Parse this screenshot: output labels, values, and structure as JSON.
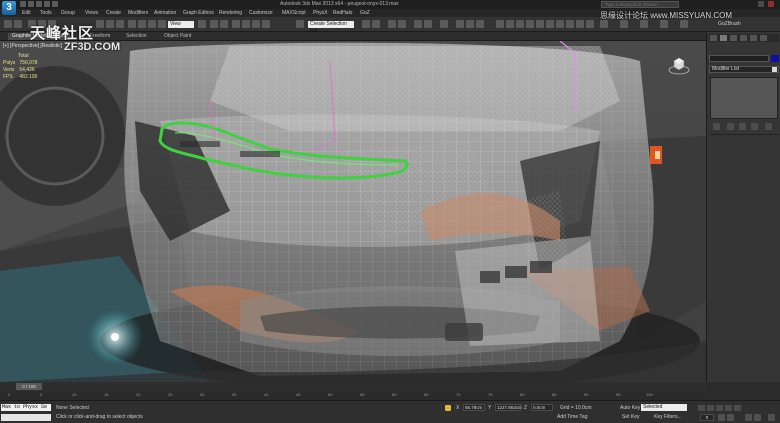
{
  "titlebar": {
    "app_badge": "3",
    "title": "Autodesk 3ds Max 2013 x64 - peugeot-onyx-013.max",
    "search_placeholder": "Type a keyword or phrase"
  },
  "menu": [
    "Edit",
    "Tools",
    "Group",
    "Views",
    "Create",
    "Modifiers",
    "Animation",
    "Graph Editors",
    "Rendering",
    "Customize",
    "MAXScript",
    "PhysX",
    "RedHalo",
    "GoZ"
  ],
  "toolbar": {
    "selection_filter": "All",
    "reference_coord": "View",
    "named_selection": "Create Selection Set"
  },
  "ribbon": {
    "tabs": [
      "Graphite Modeling Tools",
      "Freeform",
      "Selection",
      "Object Paint"
    ]
  },
  "viewport": {
    "label": "[+] [Perspective] [Realistic]",
    "stats": {
      "header": "Total",
      "rows": [
        {
          "key": "Polys",
          "value": "756,078"
        },
        {
          "key": "Verts",
          "value": "54,426"
        },
        {
          "key": "FPS",
          "value": "482.195"
        }
      ]
    }
  },
  "watermark": {
    "brand": "天峰社区",
    "site": "ZF3D.COM",
    "corner": "思缘设计论坛 www.MISSYUAN.COM"
  },
  "command_panel": {
    "goz_label": "GoZBrush",
    "modifier_list": "Modifier List"
  },
  "timeline": {
    "slider": "0 / 100",
    "ticks": [
      "0",
      "5",
      "10",
      "15",
      "20",
      "25",
      "30",
      "35",
      "40",
      "45",
      "50",
      "55",
      "60",
      "65",
      "70",
      "75",
      "80",
      "85",
      "90",
      "95",
      "100"
    ]
  },
  "status": {
    "maxscript": "Max to Physx Se",
    "selection": "None Selected",
    "prompt": "Click or click-and-drag to select objects",
    "x_value": "56.78cm",
    "y_value": "1227.863cm",
    "z_value": "0.0cm",
    "grid": "Grid = 10.0cm",
    "add_time_tag": "Add Time Tag",
    "auto_key": "Auto Key",
    "set_key": "Set Key",
    "key_mode": "Selected",
    "key_filters": "Key Filters...",
    "frame": "0"
  },
  "colors": {
    "accent": "#2d8fd6",
    "object_color": "#1010a0",
    "selected_wire": "#3fd13f",
    "stats_text": "#e8e08a"
  }
}
